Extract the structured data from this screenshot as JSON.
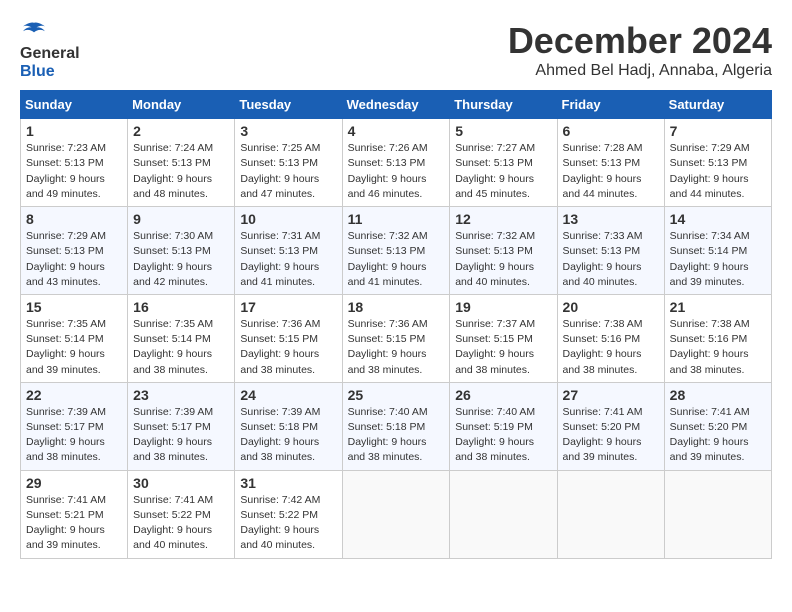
{
  "logo": {
    "general": "General",
    "blue": "Blue"
  },
  "title": "December 2024",
  "location": "Ahmed Bel Hadj, Annaba, Algeria",
  "days_of_week": [
    "Sunday",
    "Monday",
    "Tuesday",
    "Wednesday",
    "Thursday",
    "Friday",
    "Saturday"
  ],
  "weeks": [
    [
      {
        "day": "1",
        "sunrise": "Sunrise: 7:23 AM",
        "sunset": "Sunset: 5:13 PM",
        "daylight": "Daylight: 9 hours and 49 minutes."
      },
      {
        "day": "2",
        "sunrise": "Sunrise: 7:24 AM",
        "sunset": "Sunset: 5:13 PM",
        "daylight": "Daylight: 9 hours and 48 minutes."
      },
      {
        "day": "3",
        "sunrise": "Sunrise: 7:25 AM",
        "sunset": "Sunset: 5:13 PM",
        "daylight": "Daylight: 9 hours and 47 minutes."
      },
      {
        "day": "4",
        "sunrise": "Sunrise: 7:26 AM",
        "sunset": "Sunset: 5:13 PM",
        "daylight": "Daylight: 9 hours and 46 minutes."
      },
      {
        "day": "5",
        "sunrise": "Sunrise: 7:27 AM",
        "sunset": "Sunset: 5:13 PM",
        "daylight": "Daylight: 9 hours and 45 minutes."
      },
      {
        "day": "6",
        "sunrise": "Sunrise: 7:28 AM",
        "sunset": "Sunset: 5:13 PM",
        "daylight": "Daylight: 9 hours and 44 minutes."
      },
      {
        "day": "7",
        "sunrise": "Sunrise: 7:29 AM",
        "sunset": "Sunset: 5:13 PM",
        "daylight": "Daylight: 9 hours and 44 minutes."
      }
    ],
    [
      {
        "day": "8",
        "sunrise": "Sunrise: 7:29 AM",
        "sunset": "Sunset: 5:13 PM",
        "daylight": "Daylight: 9 hours and 43 minutes."
      },
      {
        "day": "9",
        "sunrise": "Sunrise: 7:30 AM",
        "sunset": "Sunset: 5:13 PM",
        "daylight": "Daylight: 9 hours and 42 minutes."
      },
      {
        "day": "10",
        "sunrise": "Sunrise: 7:31 AM",
        "sunset": "Sunset: 5:13 PM",
        "daylight": "Daylight: 9 hours and 41 minutes."
      },
      {
        "day": "11",
        "sunrise": "Sunrise: 7:32 AM",
        "sunset": "Sunset: 5:13 PM",
        "daylight": "Daylight: 9 hours and 41 minutes."
      },
      {
        "day": "12",
        "sunrise": "Sunrise: 7:32 AM",
        "sunset": "Sunset: 5:13 PM",
        "daylight": "Daylight: 9 hours and 40 minutes."
      },
      {
        "day": "13",
        "sunrise": "Sunrise: 7:33 AM",
        "sunset": "Sunset: 5:13 PM",
        "daylight": "Daylight: 9 hours and 40 minutes."
      },
      {
        "day": "14",
        "sunrise": "Sunrise: 7:34 AM",
        "sunset": "Sunset: 5:14 PM",
        "daylight": "Daylight: 9 hours and 39 minutes."
      }
    ],
    [
      {
        "day": "15",
        "sunrise": "Sunrise: 7:35 AM",
        "sunset": "Sunset: 5:14 PM",
        "daylight": "Daylight: 9 hours and 39 minutes."
      },
      {
        "day": "16",
        "sunrise": "Sunrise: 7:35 AM",
        "sunset": "Sunset: 5:14 PM",
        "daylight": "Daylight: 9 hours and 38 minutes."
      },
      {
        "day": "17",
        "sunrise": "Sunrise: 7:36 AM",
        "sunset": "Sunset: 5:15 PM",
        "daylight": "Daylight: 9 hours and 38 minutes."
      },
      {
        "day": "18",
        "sunrise": "Sunrise: 7:36 AM",
        "sunset": "Sunset: 5:15 PM",
        "daylight": "Daylight: 9 hours and 38 minutes."
      },
      {
        "day": "19",
        "sunrise": "Sunrise: 7:37 AM",
        "sunset": "Sunset: 5:15 PM",
        "daylight": "Daylight: 9 hours and 38 minutes."
      },
      {
        "day": "20",
        "sunrise": "Sunrise: 7:38 AM",
        "sunset": "Sunset: 5:16 PM",
        "daylight": "Daylight: 9 hours and 38 minutes."
      },
      {
        "day": "21",
        "sunrise": "Sunrise: 7:38 AM",
        "sunset": "Sunset: 5:16 PM",
        "daylight": "Daylight: 9 hours and 38 minutes."
      }
    ],
    [
      {
        "day": "22",
        "sunrise": "Sunrise: 7:39 AM",
        "sunset": "Sunset: 5:17 PM",
        "daylight": "Daylight: 9 hours and 38 minutes."
      },
      {
        "day": "23",
        "sunrise": "Sunrise: 7:39 AM",
        "sunset": "Sunset: 5:17 PM",
        "daylight": "Daylight: 9 hours and 38 minutes."
      },
      {
        "day": "24",
        "sunrise": "Sunrise: 7:39 AM",
        "sunset": "Sunset: 5:18 PM",
        "daylight": "Daylight: 9 hours and 38 minutes."
      },
      {
        "day": "25",
        "sunrise": "Sunrise: 7:40 AM",
        "sunset": "Sunset: 5:18 PM",
        "daylight": "Daylight: 9 hours and 38 minutes."
      },
      {
        "day": "26",
        "sunrise": "Sunrise: 7:40 AM",
        "sunset": "Sunset: 5:19 PM",
        "daylight": "Daylight: 9 hours and 38 minutes."
      },
      {
        "day": "27",
        "sunrise": "Sunrise: 7:41 AM",
        "sunset": "Sunset: 5:20 PM",
        "daylight": "Daylight: 9 hours and 39 minutes."
      },
      {
        "day": "28",
        "sunrise": "Sunrise: 7:41 AM",
        "sunset": "Sunset: 5:20 PM",
        "daylight": "Daylight: 9 hours and 39 minutes."
      }
    ],
    [
      {
        "day": "29",
        "sunrise": "Sunrise: 7:41 AM",
        "sunset": "Sunset: 5:21 PM",
        "daylight": "Daylight: 9 hours and 39 minutes."
      },
      {
        "day": "30",
        "sunrise": "Sunrise: 7:41 AM",
        "sunset": "Sunset: 5:22 PM",
        "daylight": "Daylight: 9 hours and 40 minutes."
      },
      {
        "day": "31",
        "sunrise": "Sunrise: 7:42 AM",
        "sunset": "Sunset: 5:22 PM",
        "daylight": "Daylight: 9 hours and 40 minutes."
      },
      null,
      null,
      null,
      null
    ]
  ]
}
